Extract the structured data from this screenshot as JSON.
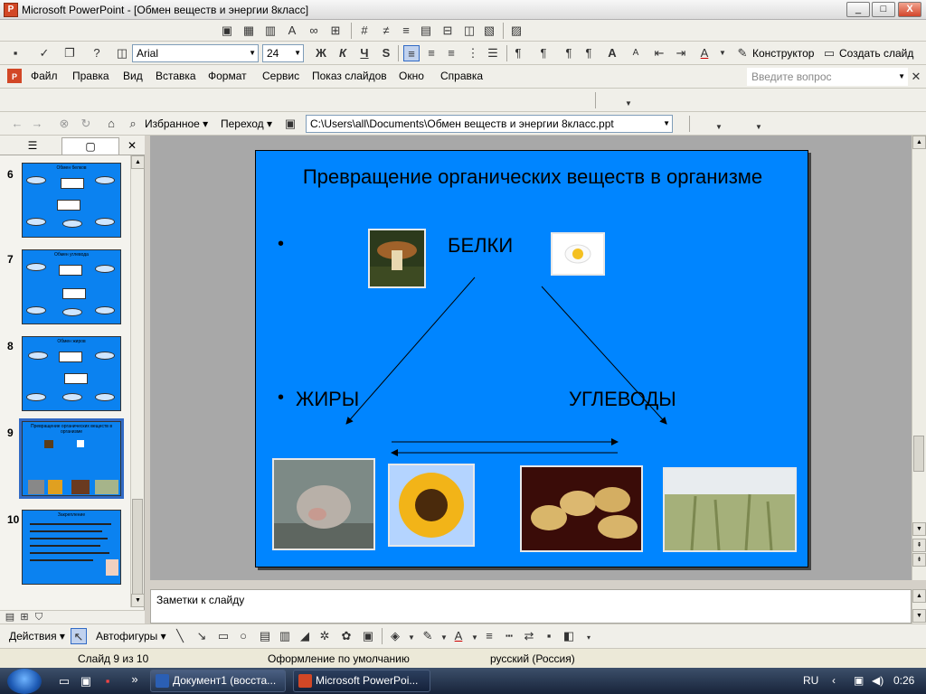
{
  "window": {
    "title": "Microsoft PowerPoint - [Обмен веществ и энергии 8класс]",
    "min": "_",
    "max": "□",
    "close": "X"
  },
  "format_toolbar": {
    "font_name": "Arial",
    "font_size": "24",
    "bold": "Ж",
    "italic": "К",
    "underline": "Ч",
    "shadow": "S",
    "designer_label": "Конструктор",
    "new_slide_label": "Создать слайд"
  },
  "menu": {
    "items": [
      "Файл",
      "Правка",
      "Вид",
      "Вставка",
      "Формат",
      "Сервис",
      "Показ слайдов",
      "Окно",
      "Справка"
    ],
    "help_placeholder": "Введите вопрос"
  },
  "web_toolbar": {
    "favorites_label": "Избранное",
    "go_label": "Переход",
    "address": "C:\\Users\\all\\Documents\\Обмен веществ и энергии 8класс.ppt"
  },
  "thumbnails": [
    {
      "num": "6",
      "title": "Обмен белков"
    },
    {
      "num": "7",
      "title": "Обмен углевода"
    },
    {
      "num": "8",
      "title": "Обмен жиров"
    },
    {
      "num": "9",
      "title": "Превращение органических веществ в организме"
    },
    {
      "num": "10",
      "title": "Закрепление"
    }
  ],
  "slide": {
    "title": "Превращение органических веществ в организме",
    "proteins": "БЕЛКИ",
    "fats": "ЖИРЫ",
    "carbs": "УГЛЕВОДЫ",
    "bullet": "•",
    "background_color": "#0085ff"
  },
  "notes": {
    "placeholder": "Заметки к слайду"
  },
  "draw_toolbar": {
    "actions_label": "Действия",
    "autoshapes_label": "Автофигуры"
  },
  "status": {
    "slide_of": "Слайд 9 из 10",
    "design": "Оформление по умолчанию",
    "language": "русский (Россия)"
  },
  "taskbar": {
    "tasks": [
      {
        "label": "Документ1 (восста..."
      },
      {
        "label": "Microsoft PowerPoi..."
      }
    ],
    "lang": "RU",
    "clock": "0:26"
  }
}
